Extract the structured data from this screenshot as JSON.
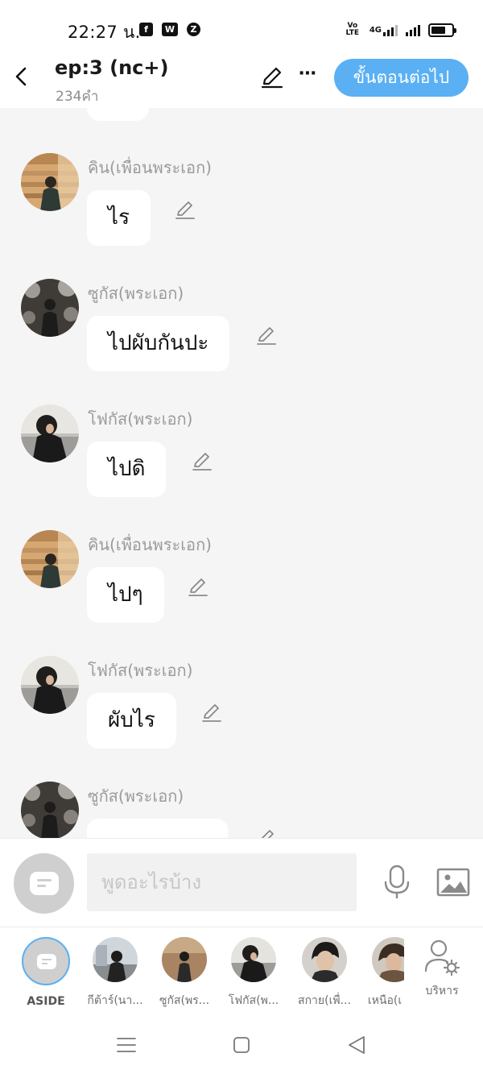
{
  "status_bar": {
    "time": "22:27 น.",
    "apps": [
      "f",
      "W",
      "Z"
    ],
    "volte": "Vo LTE",
    "network": "4G",
    "battery_level": 0.7
  },
  "header": {
    "title": "ep:3 (nc+)",
    "word_count": "234คำ",
    "next_label": "ขั้นตอนต่อไป"
  },
  "messages": [
    {
      "speaker": "คิน(เพื่อนพระเอก)",
      "text": "ไร",
      "avatar": "avatar-kin"
    },
    {
      "speaker": "ซูกัส(พระเอก)",
      "text": "ไปผับกันปะ",
      "avatar": "avatar-sugus"
    },
    {
      "speaker": "โฟกัส(พระเอก)",
      "text": "ไปดิ",
      "avatar": "avatar-focus"
    },
    {
      "speaker": "คิน(เพื่อนพระเอก)",
      "text": "ไปๆ",
      "avatar": "avatar-kin"
    },
    {
      "speaker": "โฟกัส(พระเอก)",
      "text": "ผับไร",
      "avatar": "avatar-focus"
    },
    {
      "speaker": "ซูกัส(พระเอก)",
      "text": "",
      "avatar": "avatar-sugus"
    }
  ],
  "input": {
    "placeholder": "พูดอะไรบ้าง"
  },
  "characters": [
    {
      "name": "ASIDE",
      "selected": true
    },
    {
      "name": "กีต้าร์(นา..."
    },
    {
      "name": "ซูกัส(พร..."
    },
    {
      "name": "โฟกัส(พ..."
    },
    {
      "name": "สกาย(เพื่..."
    },
    {
      "name": "เหนือ(เ"
    },
    {
      "name": "บริหาร"
    }
  ],
  "colors": {
    "accent": "#5ab0f3",
    "chat_background": "#f5f5f5",
    "speaker_text": "#9b9b9b"
  }
}
